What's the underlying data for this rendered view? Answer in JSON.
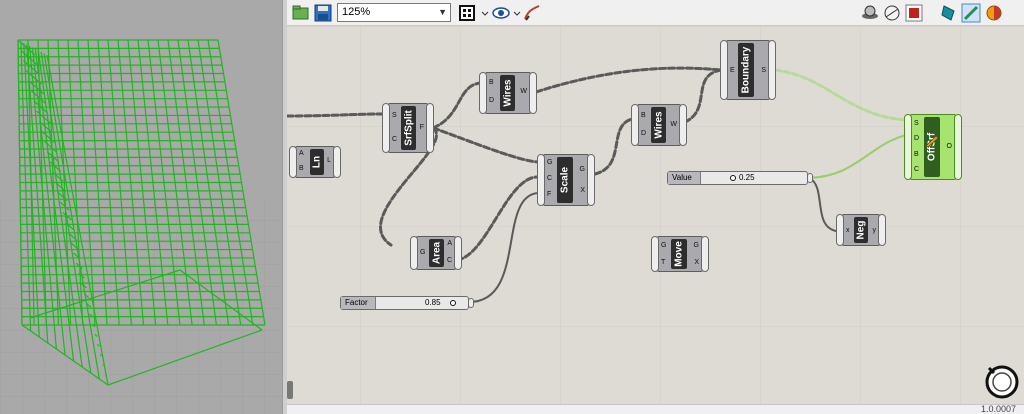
{
  "toolbar": {
    "zoom_value": "125%",
    "icons": [
      "open-file-icon",
      "save-icon",
      "zoom-select",
      "fit-view-icon",
      "eye-icon",
      "sketch-icon",
      "preview-icon",
      "bake-icon",
      "selected-preview-icon",
      "shaded-preview-icon",
      "wire-preview-icon",
      "material-icon"
    ]
  },
  "components": {
    "ln": {
      "name": "Ln",
      "inputs": [
        "A",
        "B"
      ],
      "outputs": [
        "L"
      ]
    },
    "srfsplit": {
      "name": "SrfSplit",
      "inputs": [
        "S",
        "C"
      ],
      "outputs": [
        "F"
      ]
    },
    "wires1": {
      "name": "Wires",
      "inputs": [
        "B",
        "D"
      ],
      "outputs": [
        "W"
      ]
    },
    "area": {
      "name": "Area",
      "inputs": [
        "G"
      ],
      "outputs": [
        "A",
        "C"
      ]
    },
    "scale": {
      "name": "Scale",
      "inputs": [
        "G",
        "C",
        "F"
      ],
      "outputs": [
        "G",
        "X"
      ]
    },
    "wires2": {
      "name": "Wires",
      "inputs": [
        "B",
        "D"
      ],
      "outputs": [
        "W"
      ]
    },
    "boundary": {
      "name": "Boundary",
      "inputs": [
        "E"
      ],
      "outputs": [
        "S"
      ]
    },
    "offsurf": {
      "name": "OffSrf",
      "inputs": [
        "S",
        "D",
        "B",
        "C"
      ],
      "outputs": [
        "O"
      ]
    },
    "move": {
      "name": "Move",
      "inputs": [
        "G",
        "T"
      ],
      "outputs": [
        "G",
        "X"
      ]
    },
    "neg": {
      "name": "Neg",
      "inputs": [
        "x"
      ],
      "outputs": [
        "y"
      ]
    }
  },
  "sliders": {
    "value": {
      "label": "Value",
      "value": "0.25"
    },
    "factor": {
      "label": "Factor",
      "value": "0.85"
    }
  },
  "status": {
    "text": "1.0.0007"
  },
  "colors": {
    "canvas": "#dedbd4",
    "wire": "#5a5a5a",
    "selected_wire": "#9fd36b",
    "selected_component": "#a6e36f",
    "geometry": "#22b322"
  }
}
